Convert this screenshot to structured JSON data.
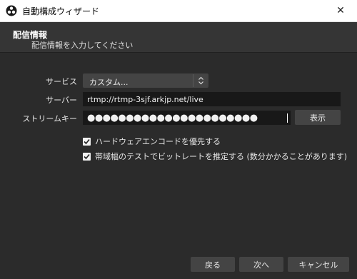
{
  "window": {
    "title": "自動構成ウィザード",
    "close_glyph": "✕"
  },
  "header": {
    "title": "配信情報",
    "subtitle": "配信情報を入力してください"
  },
  "form": {
    "service_label": "サービス",
    "service_value": "カスタム...",
    "server_label": "サーバー",
    "server_value": "rtmp://rtmp-3sjf.arkjp.net/live",
    "stream_key_label": "ストリームキー",
    "stream_key_masked": "●●●●●●●●●●●●●●●●●●●●●●",
    "show_button": "表示"
  },
  "options": [
    {
      "label": "ハードウェアエンコードを優先する",
      "checked": true
    },
    {
      "label": "帯域幅のテストでビットレートを推定する (数分かかることがあります)",
      "checked": true
    }
  ],
  "footer": {
    "back": "戻る",
    "next": "次へ",
    "cancel": "キャンセル"
  }
}
